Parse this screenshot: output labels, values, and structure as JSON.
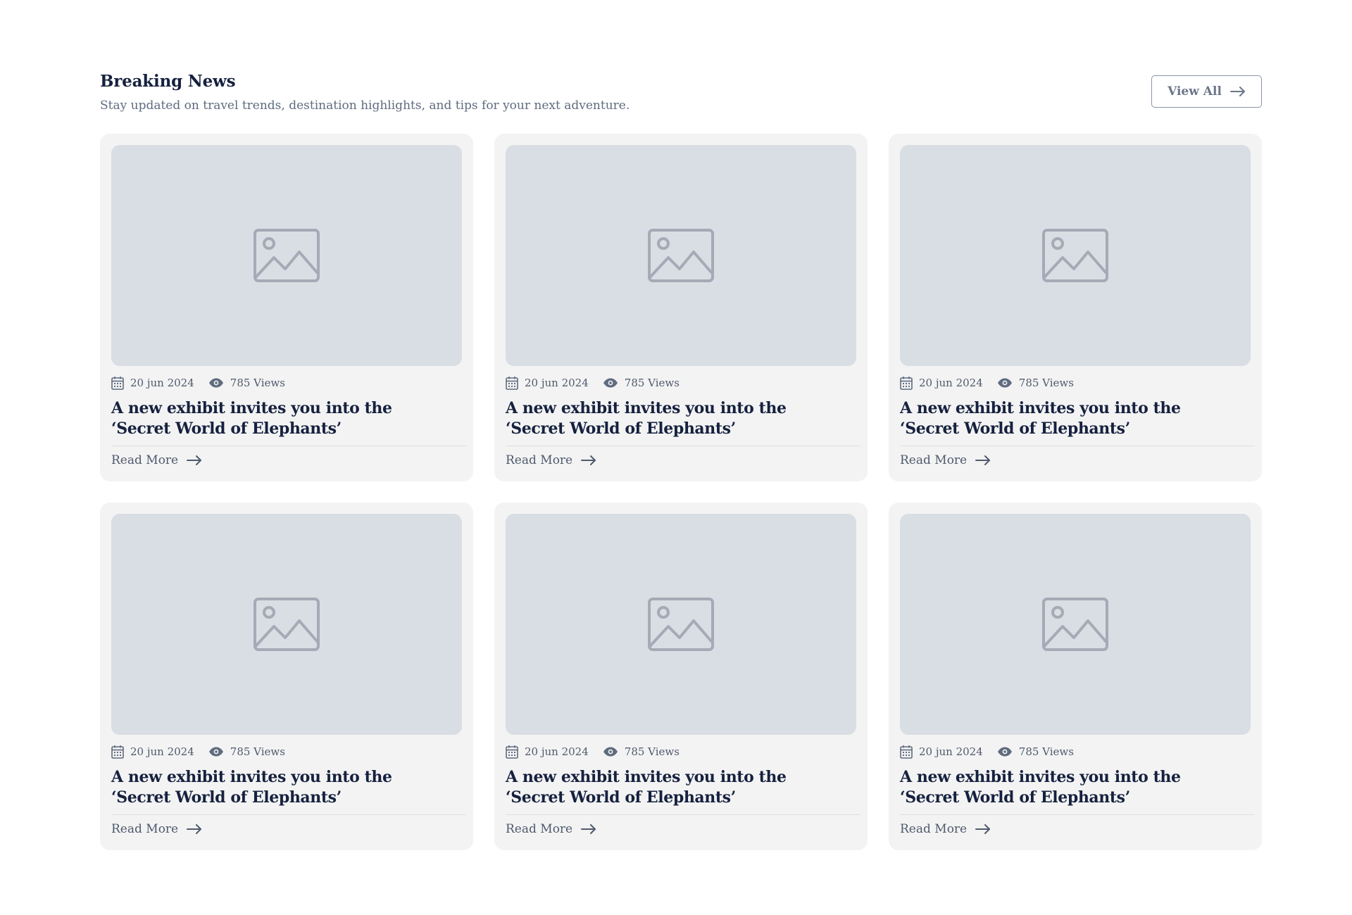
{
  "header": {
    "title": "Breaking News",
    "subtitle": "Stay updated on travel trends, destination highlights, and tips for your next adventure.",
    "view_all_label": "View All"
  },
  "colors": {
    "title": "#16213f",
    "card_background": "#f3f3f3",
    "image_placeholder": "#d9dee4",
    "icon_gray": "#a4abb6",
    "meta_text": "#4f5a6d"
  },
  "icons": {
    "calendar": "calendar-icon",
    "views": "eye-icon",
    "arrow": "arrow-right-icon",
    "placeholder": "image-placeholder-icon"
  },
  "cards": [
    {
      "date": "20 jun 2024",
      "views": "785 Views",
      "title": "A new exhibit invites you into the ‘Secret World of Elephants’",
      "read_more": "Read More"
    },
    {
      "date": "20 jun 2024",
      "views": "785 Views",
      "title": "A new exhibit invites you into the ‘Secret World of Elephants’",
      "read_more": "Read More"
    },
    {
      "date": "20 jun 2024",
      "views": "785 Views",
      "title": "A new exhibit invites you into the ‘Secret World of Elephants’",
      "read_more": "Read More"
    },
    {
      "date": "20 jun 2024",
      "views": "785 Views",
      "title": "A new exhibit invites you into the ‘Secret World of Elephants’",
      "read_more": "Read More"
    },
    {
      "date": "20 jun 2024",
      "views": "785 Views",
      "title": "A new exhibit invites you into the ‘Secret World of Elephants’",
      "read_more": "Read More"
    },
    {
      "date": "20 jun 2024",
      "views": "785 Views",
      "title": "A new exhibit invites you into the ‘Secret World of Elephants’",
      "read_more": "Read More"
    }
  ]
}
